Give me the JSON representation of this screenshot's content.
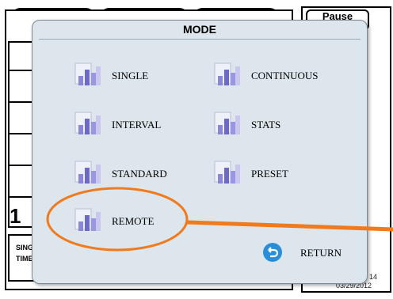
{
  "background": {
    "pause_label": "Pause",
    "big_number": "1",
    "bottom_text_line1": "SING",
    "bottom_text_line2": "TIME",
    "num_readout": "14",
    "date": "03/29/2012"
  },
  "modal": {
    "title": "MODE",
    "items": [
      {
        "label": "SINGLE"
      },
      {
        "label": "CONTINUOUS"
      },
      {
        "label": "INTERVAL"
      },
      {
        "label": "STATS"
      },
      {
        "label": "STANDARD"
      },
      {
        "label": "PRESET"
      },
      {
        "label": "REMOTE"
      }
    ],
    "return_label": "RETURN"
  },
  "colors": {
    "modal_bg": "#dce6ec",
    "annotation": "#f07a1e",
    "return_icon": "#2a8fd8",
    "tab_yellow": "#f5ef2a",
    "tab_purple": "#b488e0"
  }
}
